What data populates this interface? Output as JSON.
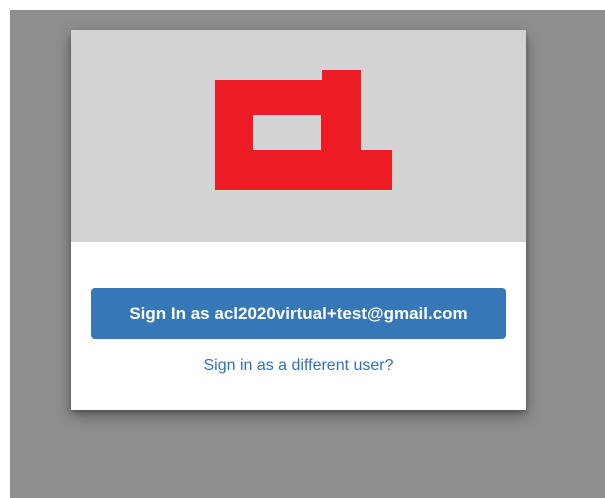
{
  "logo": {
    "icon": "red-block-logo",
    "color": "#ed1c24",
    "background": "#d3d3d3"
  },
  "signin": {
    "button_label": "Sign In as acl2020virtual+test@gmail.com",
    "button_color": "#3678b7",
    "alt_link_label": "Sign in as a different user?",
    "link_color": "#2f72b4"
  }
}
